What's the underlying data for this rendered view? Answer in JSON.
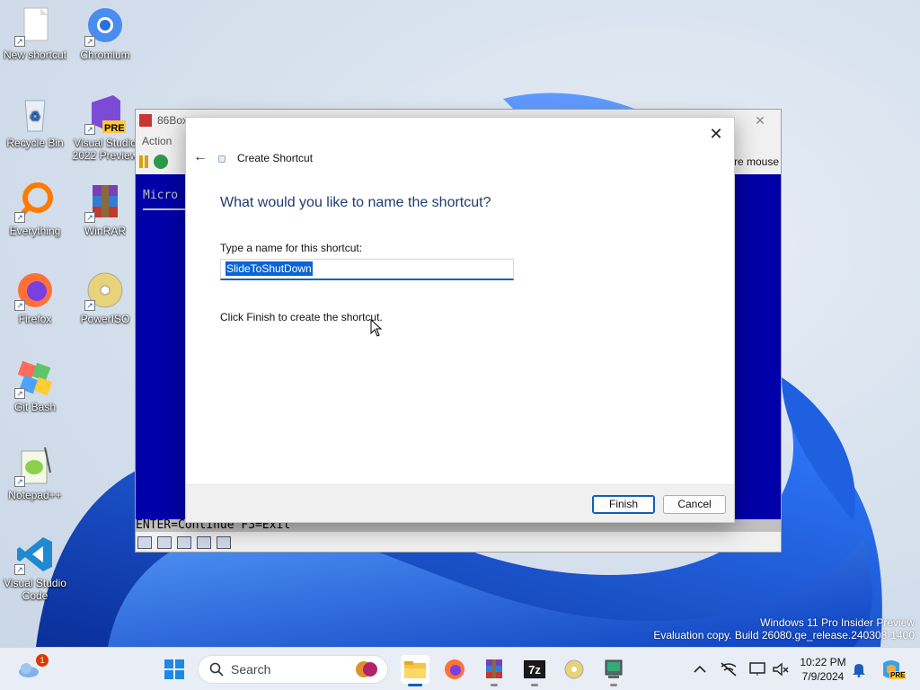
{
  "desktop": {
    "icons": [
      {
        "label": "New shortcut"
      },
      {
        "label": "Chromium"
      },
      {
        "label": "Recycle Bin"
      },
      {
        "label": "Visual Studio 2022 Preview"
      },
      {
        "label": "Everything"
      },
      {
        "label": "WinRAR"
      },
      {
        "label": "Firefox"
      },
      {
        "label": "PowerISO"
      },
      {
        "label": "Git Bash"
      },
      {
        "label": "Notepad++"
      },
      {
        "label": "Visual Studio Code"
      }
    ],
    "pre_badge": "PRE"
  },
  "box_window": {
    "title": "86Box",
    "menu_action": "Action",
    "toolbar_right_text": "re mouse",
    "screen_text": "Micro",
    "status_line": "ENTER=Continue  F3=Exit"
  },
  "dialog": {
    "title": "Create Shortcut",
    "heading": "What would you like to name the shortcut?",
    "name_label": "Type a name for this shortcut:",
    "name_value": "SlideToShutDown",
    "info_text": "Click Finish to create the shortcut.",
    "finish_label": "Finish",
    "cancel_label": "Cancel",
    "close_glyph": "✕",
    "back_glyph": "←"
  },
  "watermark": {
    "line1": "Windows 11 Pro Insider Preview",
    "line2": "Evaluation copy. Build 26080.ge_release.240308-1400"
  },
  "taskbar": {
    "search_placeholder": "Search",
    "weather_badge": "1",
    "clock_time": "10:22 PM",
    "clock_date": "7/9/2024",
    "sevenzip_label": "7z",
    "copilot_badge": "PRE"
  },
  "colors": {
    "accent": "#0f5fb8",
    "box_screen_bg": "#0000a8",
    "heading": "#1e3b70"
  }
}
